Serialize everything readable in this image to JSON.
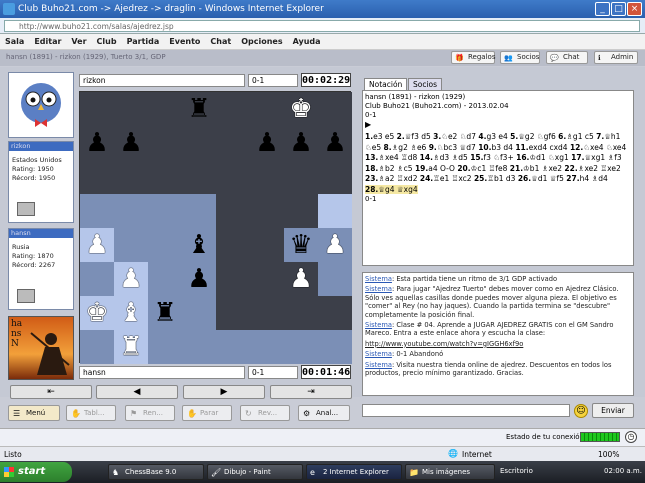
{
  "window": {
    "title": "Club Buho21.com -> Ajedrez -> draglin - Windows Internet Explorer",
    "url": "http://www.buho21.com/salas/ajedrez.jsp"
  },
  "menu": [
    "Sala",
    "Editar",
    "Ver",
    "Club",
    "Partida",
    "Evento",
    "Chat",
    "Opciones",
    "Ayuda"
  ],
  "info": {
    "text": "hansn (1891) - rizkon (1929), Tuerto 3/1, GDP"
  },
  "toolbar": {
    "regalos": "Regalos",
    "socios": "Socios",
    "chat": "Chat",
    "admin": "Admin"
  },
  "top_player": {
    "name": "rizkon",
    "country": "Estados Unidos",
    "rating": "Rating: 1950",
    "record": "Récord: 1950",
    "field": "rizkon",
    "score": "0-1",
    "clock": "00:02:29"
  },
  "bottom_player": {
    "name": "hansn",
    "country": "Rusia",
    "rating": "Rating: 1870",
    "record": "Récord: 2267",
    "field": "hansn",
    "score": "0-1",
    "clock": "00:01:46"
  },
  "logo_text": "hansN",
  "nav": [
    "⇤",
    "◀",
    "▶",
    "⇥"
  ],
  "bottom_buttons": {
    "menu": "Menú",
    "tablas": "Tabl...",
    "rendir": "Ren...",
    "parar": "Parar",
    "revancha": "Rev...",
    "analisis": "Anal...",
    "enviar": "Enviar"
  },
  "tabs": {
    "notacion": "Notación",
    "socios": "Socios"
  },
  "notation": {
    "line1": "hansn (1891) - rizkon (1929)",
    "line2": "Club Buho21 (Buho21.com) - 2013.02.04",
    "line3": "0-1",
    "moves": [
      {
        "n": "1.",
        "t": "e3 e5"
      },
      {
        "n": "2.",
        "t": "♕f3 d5"
      },
      {
        "n": "3.",
        "t": "♘e2 ♘d7"
      },
      {
        "n": "4.",
        "t": "g3 e4"
      },
      {
        "n": "5.",
        "t": "♕g2 ♘gf6"
      },
      {
        "n": "6.",
        "t": "♗g1 c5"
      },
      {
        "n": "7.",
        "t": "♕h1 ♘e5"
      },
      {
        "n": "8.",
        "t": "♗g2 ♗e6"
      },
      {
        "n": "9.",
        "t": "♘bc3 ♕d7"
      },
      {
        "n": "10.",
        "t": "b3 d4"
      },
      {
        "n": "11.",
        "t": "exd4 cxd4"
      },
      {
        "n": "12.",
        "t": "♘xe4 ♘xe4"
      },
      {
        "n": "13.",
        "t": "♗xe4 ♖d8"
      },
      {
        "n": "14.",
        "t": "♗d3 ♗d5"
      },
      {
        "n": "15.",
        "t": "f3 ♘f3+"
      },
      {
        "n": "16.",
        "t": "♔d1 ♘xg1"
      },
      {
        "n": "17.",
        "t": "♕xg1 ♗f3"
      },
      {
        "n": "18.",
        "t": "♗b2 ♗c5"
      },
      {
        "n": "19.",
        "t": "a4 O-O"
      },
      {
        "n": "20.",
        "t": "♔c1"
      },
      {
        "n": "",
        "t": "♖fe8"
      },
      {
        "n": "21.",
        "t": "♔b1 ♗xe2"
      },
      {
        "n": "22.",
        "t": "♗xe2 ♖xe2"
      },
      {
        "n": "23.",
        "t": "♗a2 ♖xd2"
      },
      {
        "n": "24.",
        "t": "♖e1"
      },
      {
        "n": "",
        "t": "♖xc2"
      },
      {
        "n": "25.",
        "t": "♖b1 d3"
      },
      {
        "n": "26.",
        "t": "♕d1 ♕f5"
      },
      {
        "n": "27.",
        "t": "h4 ♗d4"
      },
      {
        "n": "28.",
        "t": "♕g4 ♕xg4"
      }
    ],
    "result": "0-1"
  },
  "chat": [
    {
      "who": "Sistema",
      "text": ": Esta partida tiene un ritmo de 3/1 GDP activado"
    },
    {
      "who": "Sistema",
      "text": ": Para jugar \"Ajedrez Tuerto\" debes mover como en Ajedrez Clásico. Sólo ves aquellas casillas donde puedes mover alguna pieza. El objetivo es \"comer\" al Rey (no hay jaques). Cuando la partida termina se \"descubre\" completamente la posición final."
    },
    {
      "who": "Sistema",
      "text": ": Clase # 04. Aprende a JUGAR AJEDREZ GRATIS con el GM Sandro Mareco. Entra a este enlace ahora y escucha la clase:"
    },
    {
      "who": "",
      "text": "http://www.youtube.com/watch?v=gIGGH6xf9o"
    },
    {
      "who": "Sistema",
      "text": ": 0-1 Abandonó"
    },
    {
      "who": "Sistema",
      "text": ": Visita nuestra tienda online de ajedrez. Descuentos en todos los productos, precio mínimo garantizado. Gracias."
    }
  ],
  "status": {
    "listo": "Listo",
    "conexion": "Estado de tu conexión:",
    "internet": "Internet",
    "zoom": "100%"
  },
  "taskbar": {
    "start": "start",
    "items": [
      "ChessBase 9.0",
      "Dibujo - Paint",
      "2 Internet Explorer",
      "Mis imágenes"
    ],
    "escritorio": "Escritorio",
    "time": "02:00 a.m."
  }
}
